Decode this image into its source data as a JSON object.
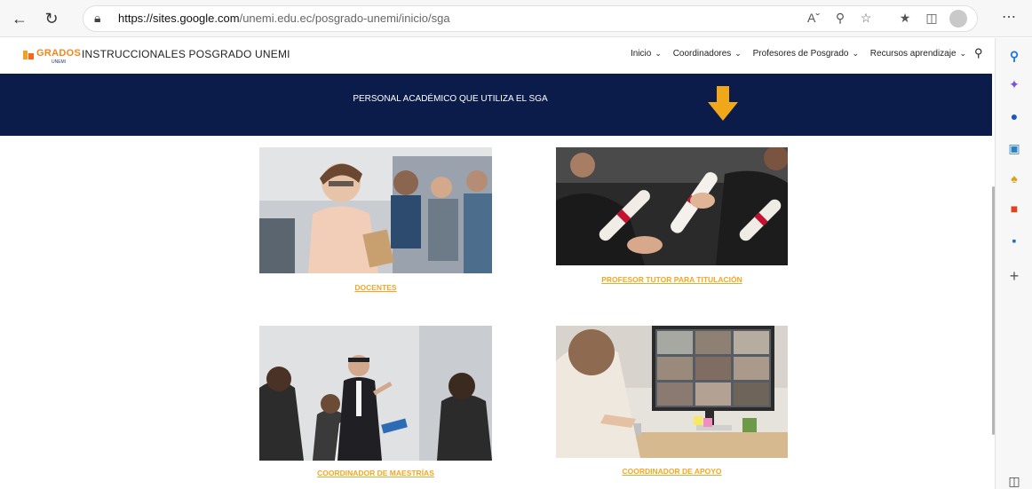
{
  "browser": {
    "url_domain": "https://sites.google.com",
    "url_path": "/unemi.edu.ec/posgrado-unemi/inicio/sga",
    "icons": [
      "back-icon",
      "reload-icon",
      "lock-icon",
      "read-aloud-icon",
      "zoom-icon",
      "favorites-add-icon",
      "favorites-icon",
      "collections-icon",
      "profile-icon",
      "menu-icon"
    ]
  },
  "sidebar": {
    "icons": [
      "search-icon",
      "copilot-icon",
      "shopping-icon",
      "tools-icon",
      "games-icon",
      "office-icon",
      "outlook-icon",
      "add-icon",
      "sidebar-toggle-icon"
    ]
  },
  "site": {
    "logo_text": "GRADOS",
    "logo_sub": "UNEMI",
    "title": "INSTRUCCIONALES POSGRADO UNEMI",
    "nav": [
      "Inicio",
      "Coordinadores",
      "Profesores de Posgrado",
      "Recursos aprendizaje"
    ]
  },
  "banner": {
    "text": "PERSONAL ACADÉMICO QUE UTILIZA EL SGA",
    "arrow_color": "#f0a81a"
  },
  "cards": [
    {
      "label": "DOCENTES"
    },
    {
      "label": "PROFESOR TUTOR PARA TITULACIÓN"
    },
    {
      "label": "COORDINADOR DE MAESTRÍAS"
    },
    {
      "label": "COORDINADOR DE APOYO"
    }
  ],
  "colors": {
    "banner_bg": "#0b1c4a",
    "accent": "#f5a623"
  }
}
